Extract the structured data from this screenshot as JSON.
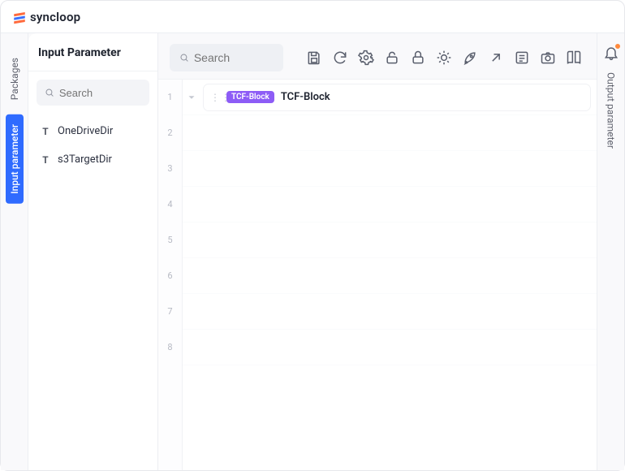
{
  "brand": {
    "name": "syncloop"
  },
  "leftRail": {
    "tabs": [
      {
        "label": "Packages",
        "active": false
      },
      {
        "label": "Input parameter",
        "active": true
      }
    ]
  },
  "sidebar": {
    "title": "Input Parameter",
    "searchPlaceholder": "Search",
    "params": [
      {
        "type": "T",
        "name": "OneDriveDir"
      },
      {
        "type": "T",
        "name": "s3TargetDir"
      }
    ]
  },
  "main": {
    "searchPlaceholder": "Search",
    "toolbarIcons": [
      "save-icon",
      "refresh-icon",
      "settings-icon",
      "unlock-icon",
      "lock-icon",
      "debug-icon",
      "launch-icon",
      "export-icon",
      "list-icon",
      "camera-icon",
      "book-icon"
    ],
    "lineCount": 8,
    "block": {
      "tag": "TCF-Block",
      "label": "TCF-Block"
    }
  },
  "rightRail": {
    "label": "Output parameter"
  },
  "colors": {
    "accent": "#2f6bff",
    "tag": "#8d5cf6",
    "notifyDot": "#ff8a3d"
  }
}
